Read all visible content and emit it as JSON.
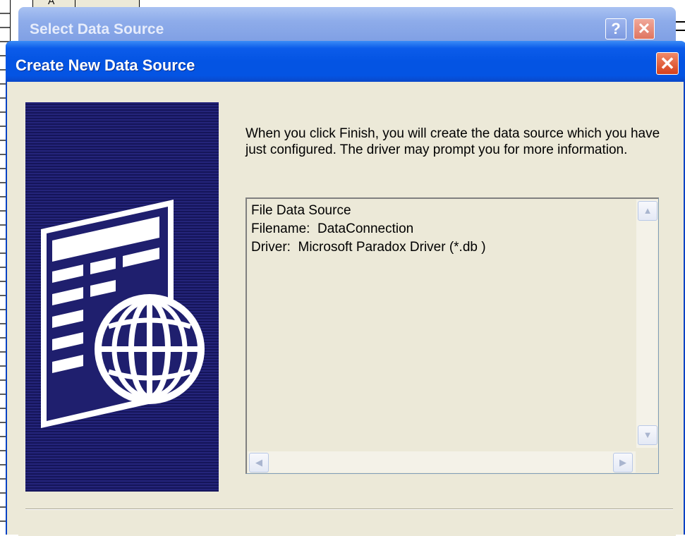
{
  "background_sheet": {
    "column_header": "A"
  },
  "back_dialog": {
    "title": "Select Data Source",
    "help_label": "?",
    "close_label": "✕"
  },
  "dialog": {
    "title": "Create New Data Source",
    "close_label": "✕",
    "message": "When you click Finish, you will create the data source which you have just configured.  The driver may prompt you for more information.",
    "info_lines": [
      "File Data Source",
      "Filename:  DataConnection",
      "Driver:  Microsoft Paradox Driver (*.db )"
    ],
    "scroll_up": "▲",
    "scroll_down": "▼",
    "scroll_left": "◀",
    "scroll_right": "▶",
    "colors": {
      "title_bar": "#0454e3",
      "dialog_bg": "#ece9d8",
      "side_image": "#1f1f6e"
    }
  }
}
